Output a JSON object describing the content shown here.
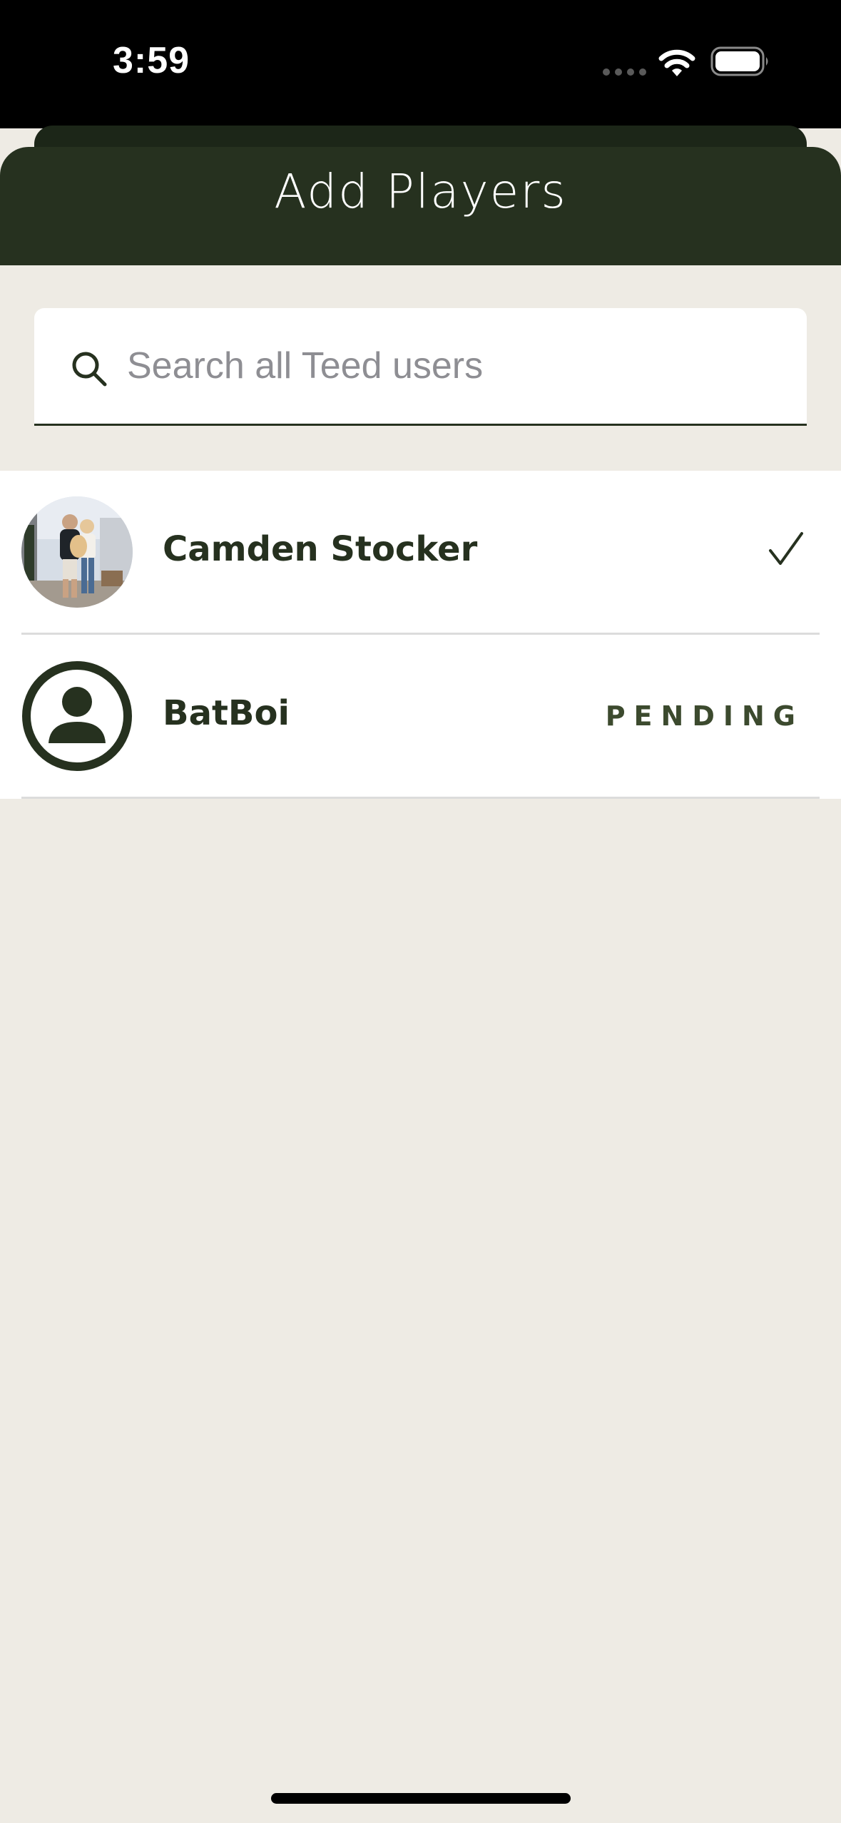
{
  "status_bar": {
    "time": "3:59",
    "wifi_icon": "wifi-icon",
    "battery_icon": "battery-icon"
  },
  "header": {
    "title": "Add Players"
  },
  "search": {
    "placeholder": "Search all Teed users",
    "value": "",
    "icon": "search-icon"
  },
  "players": [
    {
      "name": "Camden Stocker",
      "avatar": "photo",
      "status_icon": "checkmark-icon"
    },
    {
      "name": "BatBoi",
      "avatar": "default-person-icon",
      "status_text": "PENDING"
    }
  ],
  "colors": {
    "header_bg": "#26311f",
    "page_bg": "#eeebe4",
    "text_dark": "#26311f",
    "pending": "#3c4a2e"
  }
}
